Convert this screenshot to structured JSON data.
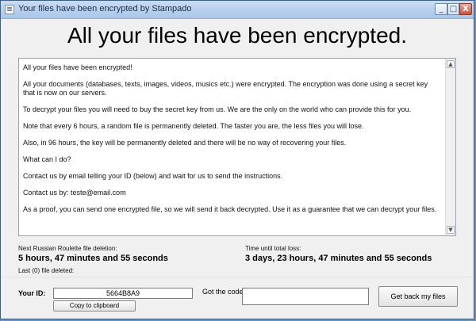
{
  "window": {
    "title": "Your files have been encrypted by Stampado",
    "controls": {
      "minimize": "_",
      "maximize": "□",
      "close": "X"
    }
  },
  "headline": "All your files have been encrypted.",
  "message": {
    "paragraphs": [
      "All your files have been encrypted!",
      "All your documents (databases, texts, images, videos, musics etc.) were encrypted. The encryption was done using a secret key that is now on our servers.",
      "To decrypt your files you will need to buy the secret key from us. We are the only on the world who can provide this for you.",
      "Note that every 6 hours, a random file is permanently deleted. The faster you are, the less files you will lose.",
      "Also, in 96 hours, the key will be permanently deleted and there will be no way of recovering your files.",
      "What can I do?",
      "Contact us by email telling your ID (below) and wait for us to send the instructions.",
      "Contact us by: teste@email.com",
      "As a proof, you can send one encrypted file, so we will send it back decrypted. Use it as a guarantee that we can decrypt your files."
    ]
  },
  "countdown": {
    "roulette_label": "Next Russian Roulette file deletion:",
    "roulette_value": "5 hours, 47 minutes and 55 seconds",
    "loss_label": "Time until total loss:",
    "loss_value": "3 days, 23 hours, 47 minutes and 55 seconds",
    "last_deleted": "Last (0) file deleted:"
  },
  "footer": {
    "id_label": "Your ID:",
    "id_value": "5664B8A9",
    "copy_button": "Copy to clipboard",
    "code_label": "Got the code?",
    "code_value": "",
    "get_files_button": "Get back my files"
  }
}
